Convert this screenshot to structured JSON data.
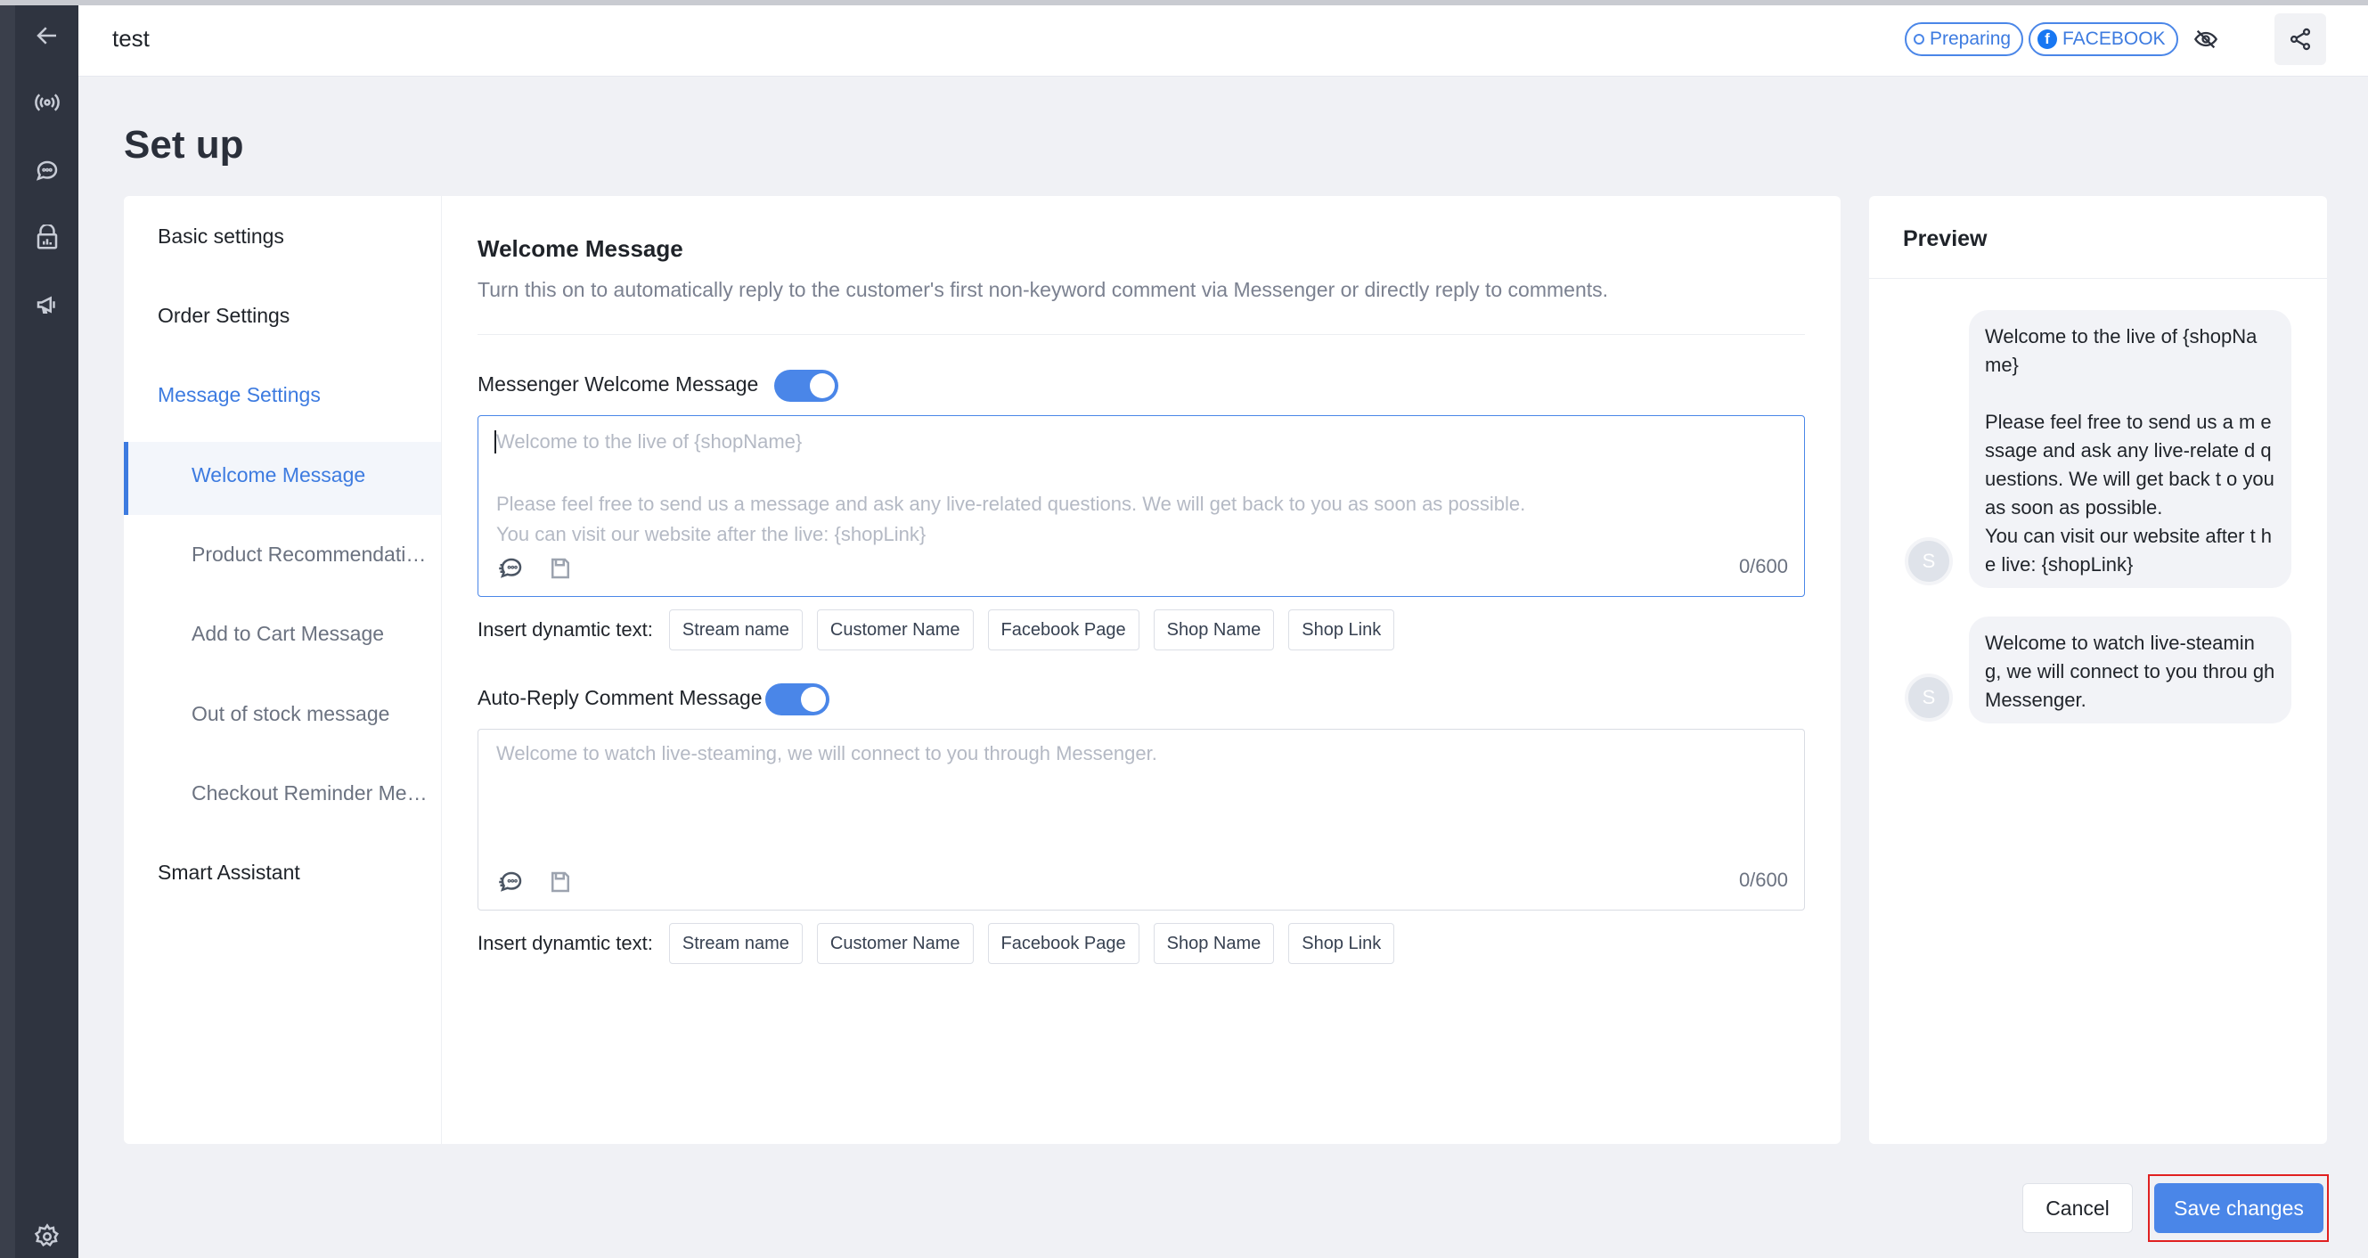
{
  "header": {
    "title": "test",
    "status_label": "Preparing",
    "platform_label": "FACEBOOK"
  },
  "page": {
    "title": "Set up"
  },
  "sidebar": {
    "items": [
      {
        "label": "Basic settings"
      },
      {
        "label": "Order Settings"
      },
      {
        "label": "Message Settings"
      }
    ],
    "sub_items": [
      {
        "label": "Welcome Message"
      },
      {
        "label": "Product Recommendation Message"
      },
      {
        "label": "Add to Cart Message"
      },
      {
        "label": "Out of stock message"
      },
      {
        "label": "Checkout Reminder Message"
      }
    ],
    "last_item": {
      "label": "Smart Assistant"
    }
  },
  "content": {
    "title": "Welcome Message",
    "description": "Turn this on to automatically reply to the customer's first non-keyword comment via Messenger or directly reply to comments.",
    "messenger": {
      "label": "Messenger Welcome Message",
      "enabled": true,
      "placeholder_lines": [
        "Welcome to the live of {shopName}",
        "Please feel free to send us a message and ask any live-related questions. We will get back to you as soon as possible.",
        "You can visit our website after the live: {shopLink}"
      ],
      "counter": "0/600"
    },
    "comment": {
      "label": "Auto-Reply Comment Message",
      "enabled": true,
      "placeholder": "Welcome to watch live-steaming, we will connect to you through Messenger.",
      "counter": "0/600"
    },
    "insert_label": "Insert dynamtic text:",
    "chips": [
      "Stream name",
      "Customer Name",
      "Facebook Page",
      "Shop Name",
      "Shop Link"
    ]
  },
  "preview": {
    "title": "Preview",
    "avatar_letter": "S",
    "messages": [
      "Welcome to the live of {shopNa me}\n\nPlease feel free to send us a m essage and ask any live-relate d questions. We will get back t o you as soon as possible.\nYou can visit our website after t he live: {shopLink}",
      "Welcome to watch live-steamin g, we will connect to you throu gh Messenger."
    ]
  },
  "footer": {
    "cancel_label": "Cancel",
    "save_label": "Save changes"
  },
  "colors": {
    "accent": "#4a86e8",
    "rail": "#2f3440",
    "highlight": "#e02020"
  }
}
